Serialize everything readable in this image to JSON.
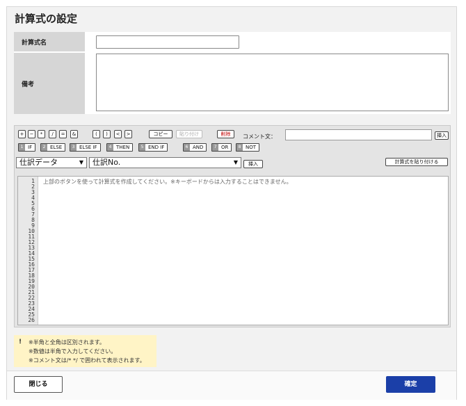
{
  "dialog": {
    "title": "計算式の設定"
  },
  "form": {
    "name_label": "計算式名",
    "name_value": "",
    "note_label": "備考",
    "note_value": ""
  },
  "toolbar": {
    "operators": [
      "+",
      "−",
      "*",
      "/",
      "=",
      "&"
    ],
    "brackets": [
      "(",
      ")",
      "<",
      ">"
    ],
    "copy_label": "コピー",
    "paste_label": "貼り付け",
    "delete_label": "削除",
    "comment_label": "コメント文：",
    "comment_value": "",
    "insert_label": "挿入",
    "keywords": [
      {
        "num": "1",
        "label": "IF"
      },
      {
        "num": "2",
        "label": "ELSE"
      },
      {
        "num": "3",
        "label": "ELSE IF"
      },
      {
        "num": "4",
        "label": "THEN"
      },
      {
        "num": "5",
        "label": "END IF"
      },
      {
        "num": "6",
        "label": "AND"
      },
      {
        "num": "7",
        "label": "OR"
      },
      {
        "num": "8",
        "label": "NOT"
      }
    ]
  },
  "field_row": {
    "category_selected": "仕訳データ",
    "field_selected": "仕訳No.",
    "insert_label": "挿入",
    "paste_formula_label": "計算式を貼り付ける"
  },
  "editor": {
    "hint": "上部のボタンを使って計算式を作成してください。※キーボードからは入力することはできません。",
    "line_numbers": [
      "1",
      "2",
      "3",
      "4",
      "5",
      "6",
      "7",
      "8",
      "9",
      "10",
      "11",
      "12",
      "13",
      "14",
      "15",
      "16",
      "17",
      "18",
      "19",
      "20",
      "21",
      "22",
      "23",
      "24",
      "25",
      "26"
    ]
  },
  "notice": {
    "icon": "!",
    "lines": [
      "※半角と全角は区別されます。",
      "※数値は半角で入力してください。",
      "※コメント文は/* */ で囲われて表示されます。"
    ]
  },
  "footer": {
    "close_label": "閉じる",
    "ok_label": "確定"
  },
  "colors": {
    "primary_button": "#1b3fa8",
    "notice_bg": "#fff4c6",
    "delete_text": "#c00000"
  }
}
